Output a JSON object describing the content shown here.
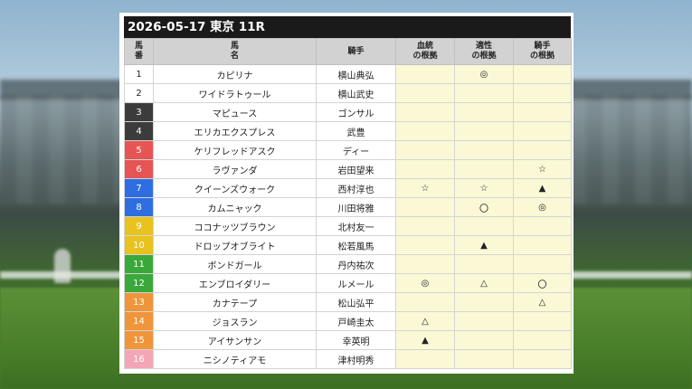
{
  "race": {
    "title": "2026-05-17 東京 11R"
  },
  "headers": {
    "num": "馬\n番",
    "name": "馬\n名",
    "jockey": "騎手",
    "blood": "血統\nの根拠",
    "aptitude": "適性\nの根拠",
    "jockey_basis": "騎手\nの根拠"
  },
  "frame_colors": {
    "1": "#ffffff",
    "2": "#ffffff",
    "3": "#3c3c3c",
    "4": "#3c3c3c",
    "5": "#e65454",
    "6": "#e65454",
    "7": "#2e6ee0",
    "8": "#2e6ee0",
    "9": "#e8c21e",
    "10": "#e8c21e",
    "11": "#3aa83a",
    "12": "#3aa83a",
    "13": "#f0953a",
    "14": "#f0953a",
    "15": "#f0953a",
    "16": "#f3a6b6"
  },
  "rows": [
    {
      "num": "1",
      "name": "カピリナ",
      "jockey": "横山典弘",
      "blood": "",
      "aptitude": "◎",
      "jockey_basis": ""
    },
    {
      "num": "2",
      "name": "ワイドラトゥール",
      "jockey": "横山武史",
      "blood": "",
      "aptitude": "",
      "jockey_basis": ""
    },
    {
      "num": "3",
      "name": "マピュース",
      "jockey": "ゴンサル",
      "blood": "",
      "aptitude": "",
      "jockey_basis": ""
    },
    {
      "num": "4",
      "name": "エリカエクスプレス",
      "jockey": "武豊",
      "blood": "",
      "aptitude": "",
      "jockey_basis": ""
    },
    {
      "num": "5",
      "name": "ケリフレッドアスク",
      "jockey": "ディー",
      "blood": "",
      "aptitude": "",
      "jockey_basis": ""
    },
    {
      "num": "6",
      "name": "ラヴァンダ",
      "jockey": "岩田望来",
      "blood": "",
      "aptitude": "",
      "jockey_basis": "☆"
    },
    {
      "num": "7",
      "name": "クイーンズウォーク",
      "jockey": "西村淳也",
      "blood": "☆",
      "aptitude": "☆",
      "jockey_basis": "▲"
    },
    {
      "num": "8",
      "name": "カムニャック",
      "jockey": "川田将雅",
      "blood": "",
      "aptitude": "〇",
      "jockey_basis": "◎"
    },
    {
      "num": "9",
      "name": "ココナッツブラウン",
      "jockey": "北村友一",
      "blood": "",
      "aptitude": "",
      "jockey_basis": ""
    },
    {
      "num": "10",
      "name": "ドロップオブライト",
      "jockey": "松若風馬",
      "blood": "",
      "aptitude": "▲",
      "jockey_basis": ""
    },
    {
      "num": "11",
      "name": "ボンドガール",
      "jockey": "丹内祐次",
      "blood": "",
      "aptitude": "",
      "jockey_basis": ""
    },
    {
      "num": "12",
      "name": "エンブロイダリー",
      "jockey": "ルメール",
      "blood": "◎",
      "aptitude": "△",
      "jockey_basis": "〇"
    },
    {
      "num": "13",
      "name": "カナテープ",
      "jockey": "松山弘平",
      "blood": "",
      "aptitude": "",
      "jockey_basis": "△"
    },
    {
      "num": "14",
      "name": "ジョスラン",
      "jockey": "戸崎圭太",
      "blood": "△",
      "aptitude": "",
      "jockey_basis": ""
    },
    {
      "num": "15",
      "name": "アイサンサン",
      "jockey": "幸英明",
      "blood": "▲",
      "aptitude": "",
      "jockey_basis": ""
    },
    {
      "num": "16",
      "name": "ニシノティアモ",
      "jockey": "津村明秀",
      "blood": "",
      "aptitude": "",
      "jockey_basis": ""
    }
  ]
}
